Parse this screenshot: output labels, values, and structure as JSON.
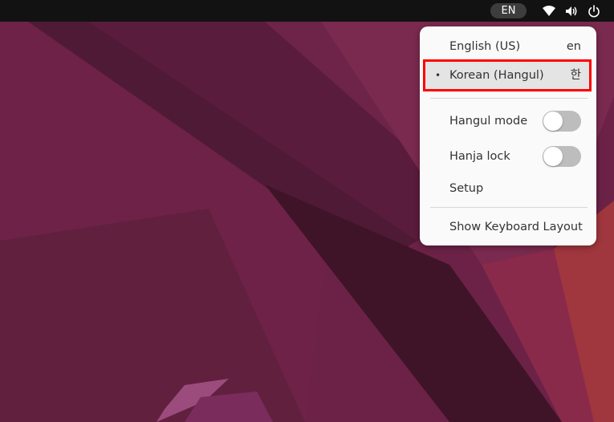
{
  "topbar": {
    "input_indicator": "EN",
    "icons": [
      "wifi-icon",
      "volume-icon",
      "power-icon"
    ]
  },
  "input_menu": {
    "sources": [
      {
        "label": "English (US)",
        "short": "en",
        "selected": false
      },
      {
        "label": "Korean (Hangul)",
        "short": "한",
        "selected": true
      }
    ],
    "bullet": "•",
    "toggles": [
      {
        "label": "Hangul mode",
        "on": false
      },
      {
        "label": "Hanja lock",
        "on": false
      }
    ],
    "setup_label": "Setup",
    "show_layout_label": "Show Keyboard Layout"
  },
  "colors": {
    "topbar": "#121212",
    "menu_bg": "#fafafa",
    "highlight_border": "#ff0000",
    "wallpaper": "#6a2347"
  }
}
